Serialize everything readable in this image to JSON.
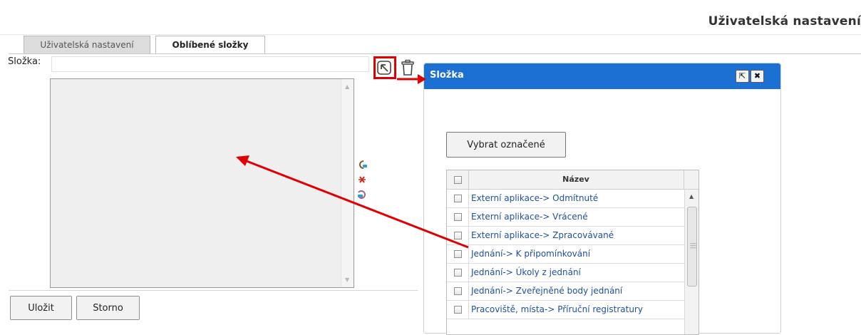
{
  "page": {
    "title": "Uživatelská nastavení"
  },
  "tabs": [
    {
      "label": "Uživatelská nastavení",
      "active": false
    },
    {
      "label": "Oblíbené složky",
      "active": true
    }
  ],
  "folder": {
    "label": "Složka:",
    "value": ""
  },
  "icons": {
    "pick": "folder-pick-icon",
    "delete": "trash-icon",
    "side": [
      "add-favorite-icon",
      "remove-favorite-icon",
      "reload-icon"
    ]
  },
  "buttons": {
    "save": "Uložit",
    "cancel": "Storno"
  },
  "dialog": {
    "title": "Složka",
    "select_button": "Vybrat označené",
    "column_header": "Název",
    "rows": [
      "Externí aplikace-> Odmítnuté",
      "Externí aplikace-> Vrácené",
      "Externí aplikace-> Zpracovávané",
      "Jednání-> K připomínkování",
      "Jednání-> Úkoly z jednání",
      "Jednání-> Zveřejněné body jednání",
      "Pracoviště, místa-> Příruční registratury"
    ]
  },
  "colors": {
    "accent": "#1c6fd3",
    "highlight": "#e00000"
  }
}
